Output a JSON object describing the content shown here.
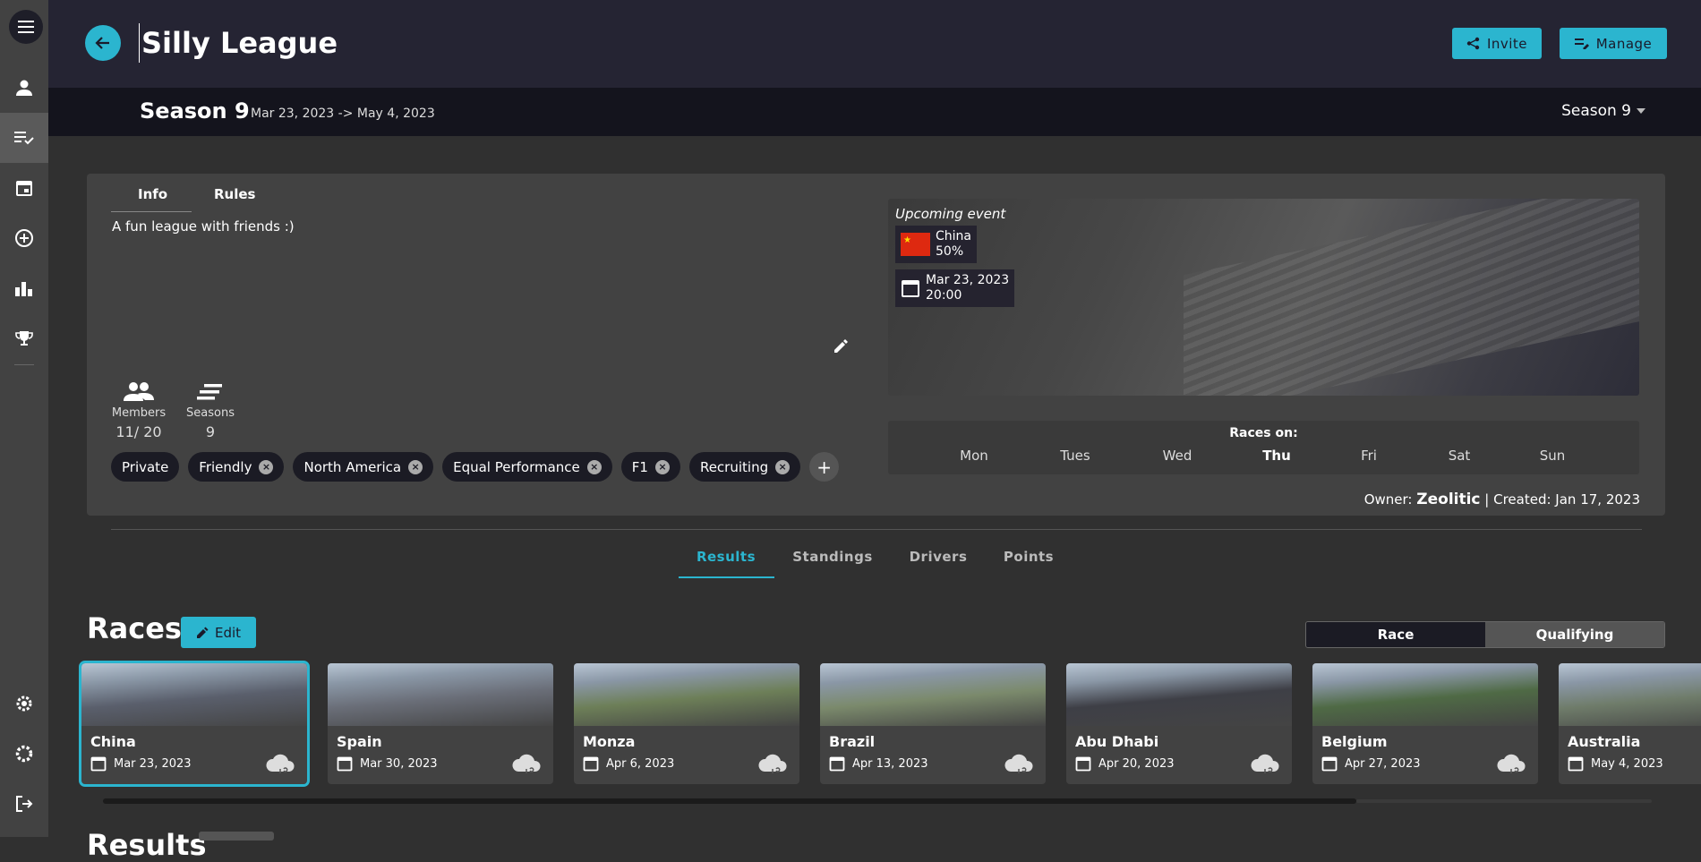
{
  "nav": {
    "items": [
      "menu-icon",
      "person-icon",
      "checklist-icon",
      "calendar-icon",
      "add-circle-icon",
      "bar-chart-icon",
      "trophy-icon",
      "help-gear-icon",
      "settings-icon",
      "logout-icon"
    ]
  },
  "header": {
    "title": "Silly League",
    "invite_label": "Invite",
    "manage_label": "Manage"
  },
  "season": {
    "name": "Season 9",
    "dates": "Mar 23, 2023 -> May 4, 2023",
    "selector": "Season 9"
  },
  "info": {
    "tabs": [
      "Info",
      "Rules"
    ],
    "description": "A fun league with friends :)",
    "members_label": "Members",
    "members_value": "11/ 20",
    "seasons_label": "Seasons",
    "seasons_value": "9",
    "tags": [
      "Private",
      "Friendly",
      "North America",
      "Equal Performance",
      "F1",
      "Recruiting"
    ]
  },
  "event": {
    "label": "Upcoming event",
    "track": "China",
    "percent": "50%",
    "date": "Mar 23, 2023",
    "time": "20:00"
  },
  "races_on": {
    "title": "Races on:",
    "days": [
      "Mon",
      "Tues",
      "Wed",
      "Thu",
      "Fri",
      "Sat",
      "Sun"
    ],
    "active_day": "Thu"
  },
  "owner": {
    "prefix": "Owner:",
    "name": "Zeolitic",
    "created": "| Created: Jan 17, 2023"
  },
  "main_tabs": [
    "Results",
    "Standings",
    "Drivers",
    "Points"
  ],
  "races": {
    "title": "Races",
    "edit_label": "Edit",
    "toggle": [
      "Race",
      "Qualifying"
    ],
    "cards": [
      {
        "name": "China",
        "date": "Mar 23, 2023",
        "img": "#5a5f6c"
      },
      {
        "name": "Spain",
        "date": "Mar 30, 2023",
        "img": "#6a6e78"
      },
      {
        "name": "Monza",
        "date": "Apr 6, 2023",
        "img": "#6d7f58"
      },
      {
        "name": "Brazil",
        "date": "Apr 13, 2023",
        "img": "#7b8a6c"
      },
      {
        "name": "Abu Dhabi",
        "date": "Apr 20, 2023",
        "img": "#3e3f46"
      },
      {
        "name": "Belgium",
        "date": "Apr 27, 2023",
        "img": "#4f6a45"
      },
      {
        "name": "Australia",
        "date": "May 4, 2023",
        "img": "#6f7c6a"
      }
    ]
  },
  "results_peek": "Results",
  "colors": {
    "accent": "#2bb5cf",
    "bg": "#303030",
    "card": "#424242",
    "topbar": "#252433"
  }
}
